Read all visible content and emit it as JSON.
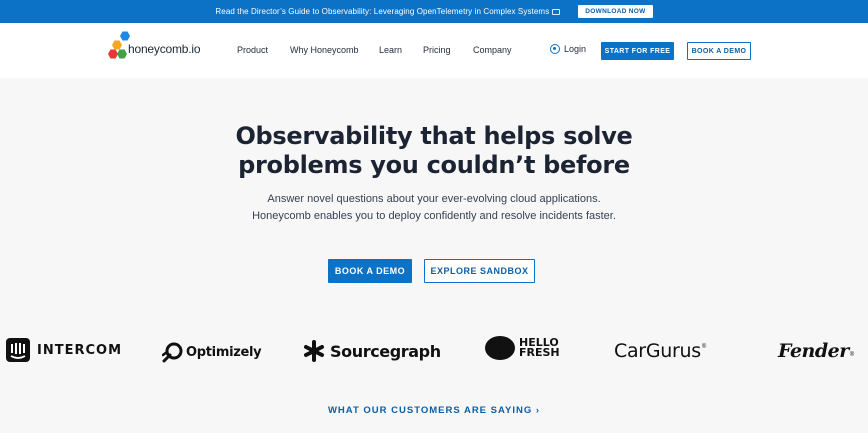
{
  "announcement": {
    "text": "Read the Director’s Guide to Observability: Leveraging OpenTelemetry in Complex Systems",
    "icon": "book-icon",
    "button": "DOWNLOAD NOW"
  },
  "header": {
    "logo_text": "honeycomb.io",
    "nav": [
      "Product",
      "Why Honeycomb",
      "Learn",
      "Pricing",
      "Company"
    ],
    "login": "Login",
    "start_button": "START FOR FREE",
    "demo_button": "BOOK A DEMO"
  },
  "hero": {
    "title_line1": "Observability that helps solve",
    "title_line2": "problems you couldn’t before",
    "sub_line1": "Answer novel questions about your ever-evolving cloud applications.",
    "sub_line2": "Honeycomb enables you to deploy confidently and resolve incidents faster.",
    "primary_button": "BOOK A DEMO",
    "secondary_button": "EXPLORE SANDBOX"
  },
  "logos": [
    "INTERCOM",
    "Optimizely",
    "Sourcegraph",
    "HELLO FRESH",
    "CarGurus",
    "Fender"
  ],
  "logo_parts": {
    "hello": "HELLO",
    "fresh": "FRESH",
    "cargurus_mark": "®"
  },
  "customers_link": "WHAT OUR CUSTOMERS ARE SAYING ›",
  "colors": {
    "brand_blue": "#0b72c6",
    "background": "#f7f7f8"
  }
}
